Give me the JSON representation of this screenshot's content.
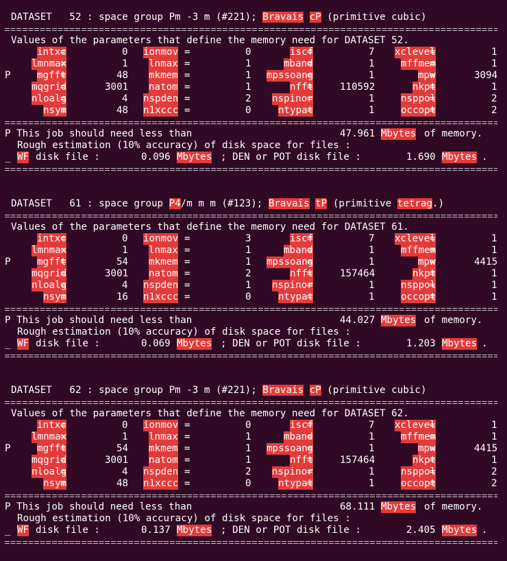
{
  "terminal": {
    "background": "#300a24",
    "highlight_color": "#e33b3b",
    "separator_char": "="
  },
  "datasets": [
    {
      "header": [
        {
          "t": "DATASET   52 : space group Pm -3 m (#221); "
        },
        {
          "t": "Bravais",
          "h": true
        },
        {
          "t": " "
        },
        {
          "t": "cP",
          "h": true
        },
        {
          "t": " (primitive cubic)"
        }
      ],
      "values_title": "Values of the parameters that define the memory need for DATASET 52.",
      "params": [
        {
          "mark": "",
          "a": [
            "intxc",
            "0"
          ],
          "b": [
            "ionmov",
            "0"
          ],
          "c": [
            "iscf",
            "7"
          ],
          "d": [
            "xclevel",
            "1"
          ]
        },
        {
          "mark": "",
          "a": [
            "lmnmax",
            "1"
          ],
          "b": [
            "lnmax",
            "1"
          ],
          "c": [
            "mband",
            "1"
          ],
          "d": [
            "mffmem",
            "1"
          ]
        },
        {
          "mark": "P",
          "a": [
            "mgfft",
            "48"
          ],
          "b": [
            "mkmem",
            "1"
          ],
          "c": [
            "mpssoang",
            "1"
          ],
          "d": [
            "mpw",
            "3094"
          ]
        },
        {
          "mark": "",
          "a": [
            "mqgrid",
            "3001"
          ],
          "b": [
            "natom",
            "1"
          ],
          "c": [
            "nfft",
            "110592"
          ],
          "d": [
            "nkpt",
            "1"
          ]
        },
        {
          "mark": "",
          "a": [
            "nloalg",
            "4"
          ],
          "b": [
            "nspden",
            "2"
          ],
          "c": [
            "nspinor",
            "1"
          ],
          "d": [
            "nsppol",
            "2"
          ]
        },
        {
          "mark": "",
          "a": [
            "nsym",
            "48"
          ],
          "b": [
            "n1xccc",
            "0"
          ],
          "c": [
            "ntypat",
            "1"
          ],
          "d": [
            "occopt",
            "2"
          ]
        }
      ],
      "memory": {
        "prefix": "P This job should need less than",
        "value": "47.961",
        "unit": "Mbytes",
        "suffix": "of memory."
      },
      "rough": "Rough estimation (10% accuracy) of disk space for files :",
      "disk": {
        "mark": "_",
        "wf": "WF",
        "wf_label": "disk file :",
        "wf_value": "0.096",
        "unit1": "Mbytes",
        "mid": "; DEN or POT disk file :",
        "den_value": "1.690",
        "unit2": "Mbytes",
        "end": "."
      }
    },
    {
      "header": [
        {
          "t": "DATASET   61 : space group "
        },
        {
          "t": "P4",
          "h": true
        },
        {
          "t": "/m m m (#123); "
        },
        {
          "t": "Bravais",
          "h": true
        },
        {
          "t": " "
        },
        {
          "t": "tP",
          "h": true
        },
        {
          "t": " (primitive "
        },
        {
          "t": "tetrag",
          "h": true
        },
        {
          "t": ".)"
        }
      ],
      "values_title": "Values of the parameters that define the memory need for DATASET 61.",
      "params": [
        {
          "mark": "",
          "a": [
            "intxc",
            "0"
          ],
          "b": [
            "ionmov",
            "3"
          ],
          "c": [
            "iscf",
            "7"
          ],
          "d": [
            "xclevel",
            "1"
          ]
        },
        {
          "mark": "",
          "a": [
            "lmnmax",
            "1"
          ],
          "b": [
            "lnmax",
            "1"
          ],
          "c": [
            "mband",
            "1"
          ],
          "d": [
            "mffmem",
            "1"
          ]
        },
        {
          "mark": "P",
          "a": [
            "mgfft",
            "54"
          ],
          "b": [
            "mkmem",
            "1"
          ],
          "c": [
            "mpssoang",
            "1"
          ],
          "d": [
            "mpw",
            "4415"
          ]
        },
        {
          "mark": "",
          "a": [
            "mqgrid",
            "3001"
          ],
          "b": [
            "natom",
            "2"
          ],
          "c": [
            "nfft",
            "157464"
          ],
          "d": [
            "nkpt",
            "1"
          ]
        },
        {
          "mark": "",
          "a": [
            "nloalg",
            "4"
          ],
          "b": [
            "nspden",
            "1"
          ],
          "c": [
            "nspinor",
            "1"
          ],
          "d": [
            "nsppol",
            "1"
          ]
        },
        {
          "mark": "",
          "a": [
            "nsym",
            "16"
          ],
          "b": [
            "n1xccc",
            "0"
          ],
          "c": [
            "ntypat",
            "1"
          ],
          "d": [
            "occopt",
            "1"
          ]
        }
      ],
      "memory": {
        "prefix": "P This job should need less than",
        "value": "44.027",
        "unit": "Mbytes",
        "suffix": "of memory."
      },
      "rough": "Rough estimation (10% accuracy) of disk space for files :",
      "disk": {
        "mark": "_",
        "wf": "WF",
        "wf_label": "disk file :",
        "wf_value": "0.069",
        "unit1": "Mbytes",
        "mid": "; DEN or POT disk file :",
        "den_value": "1.203",
        "unit2": "Mbytes",
        "end": "."
      }
    },
    {
      "header": [
        {
          "t": "DATASET   62 : space group Pm -3 m (#221); "
        },
        {
          "t": "Bravais",
          "h": true
        },
        {
          "t": " "
        },
        {
          "t": "cP",
          "h": true
        },
        {
          "t": " (primitive cubic)"
        }
      ],
      "values_title": "Values of the parameters that define the memory need for DATASET 62.",
      "params": [
        {
          "mark": "",
          "a": [
            "intxc",
            "0"
          ],
          "b": [
            "ionmov",
            "0"
          ],
          "c": [
            "iscf",
            "7"
          ],
          "d": [
            "xclevel",
            "1"
          ]
        },
        {
          "mark": "",
          "a": [
            "lmnmax",
            "1"
          ],
          "b": [
            "lnmax",
            "1"
          ],
          "c": [
            "mband",
            "1"
          ],
          "d": [
            "mffmem",
            "1"
          ]
        },
        {
          "mark": "P",
          "a": [
            "mgfft",
            "54"
          ],
          "b": [
            "mkmem",
            "1"
          ],
          "c": [
            "mpssoang",
            "1"
          ],
          "d": [
            "mpw",
            "4415"
          ]
        },
        {
          "mark": "",
          "a": [
            "mqgrid",
            "3001"
          ],
          "b": [
            "natom",
            "1"
          ],
          "c": [
            "nfft",
            "157464"
          ],
          "d": [
            "nkpt",
            "1"
          ]
        },
        {
          "mark": "",
          "a": [
            "nloalg",
            "4"
          ],
          "b": [
            "nspden",
            "2"
          ],
          "c": [
            "nspinor",
            "1"
          ],
          "d": [
            "nsppol",
            "2"
          ]
        },
        {
          "mark": "",
          "a": [
            "nsym",
            "48"
          ],
          "b": [
            "n1xccc",
            "0"
          ],
          "c": [
            "ntypat",
            "1"
          ],
          "d": [
            "occopt",
            "2"
          ]
        }
      ],
      "memory": {
        "prefix": "P This job should need less than",
        "value": "68.111",
        "unit": "Mbytes",
        "suffix": "of memory."
      },
      "rough": "Rough estimation (10% accuracy) of disk space for files :",
      "disk": {
        "mark": "_",
        "wf": "WF",
        "wf_label": "disk file :",
        "wf_value": "0.137",
        "unit1": "Mbytes",
        "mid": "; DEN or POT disk file :",
        "den_value": "2.405",
        "unit2": "Mbytes",
        "end": "."
      }
    }
  ]
}
